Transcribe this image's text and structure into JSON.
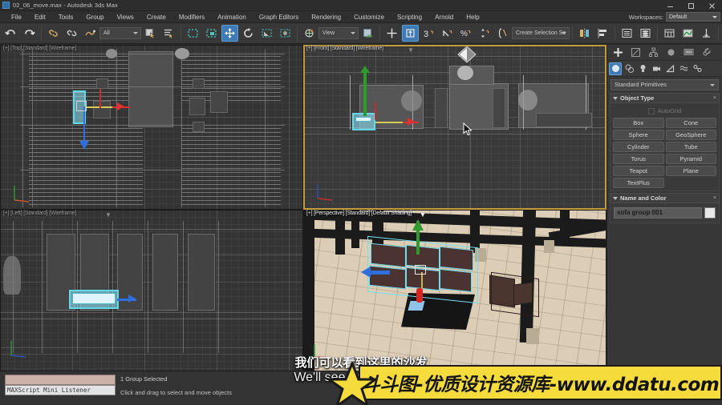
{
  "window": {
    "title": "02_06_move.max - Autodesk 3ds Max",
    "app_icon": "max-logo-icon",
    "minimize": "minimize-icon",
    "maximize": "maximize-icon",
    "close": "close-icon"
  },
  "menu": {
    "items": [
      "File",
      "Edit",
      "Tools",
      "Group",
      "Views",
      "Create",
      "Modifiers",
      "Animation",
      "Graph Editors",
      "Rendering",
      "Customize",
      "Scripting",
      "Arnold",
      "Help"
    ]
  },
  "workspaces": {
    "label": "Workspaces:",
    "value": "Default"
  },
  "toolbar": {
    "filter_value": "All",
    "ref_coord_value": "View",
    "selection_set_value": "Create Selection Se",
    "active_tool": "select-and-move",
    "buttons": [
      "undo-icon",
      "redo-icon",
      "select-and-link-icon",
      "unlink-selection-icon",
      "bind-to-space-warp-icon",
      "select-object-icon",
      "select-by-name-icon",
      "rectangular-selection-region-icon",
      "window-crossing-icon",
      "select-and-move-icon",
      "select-and-rotate-icon",
      "select-and-scale-icon",
      "use-center-flyout-icon",
      "select-and-manipulate-icon",
      "snaps-toggle-icon",
      "angle-snap-icon",
      "percent-snap-icon",
      "spinner-snap-icon",
      "named-selection-sets-icon",
      "mirror-icon",
      "align-icon",
      "layer-explorer-icon",
      "scene-explorer-icon",
      "ribbon-toggle-icon",
      "curve-editor-icon",
      "schematic-view-icon",
      "material-editor-icon",
      "render-setup-icon",
      "rendered-frame-icon",
      "render-production-icon"
    ]
  },
  "command_panel": {
    "tabs": [
      "create-tab",
      "modify-tab",
      "hierarchy-tab",
      "motion-tab",
      "display-tab",
      "utilities-tab"
    ],
    "active_tab": "create-tab",
    "categories": [
      "geometry-category",
      "shapes-category",
      "lights-category",
      "cameras-category",
      "helpers-category",
      "space-warps-category",
      "systems-category"
    ],
    "active_category": "geometry-category",
    "subcategory": "Standard Primitives",
    "object_type": {
      "title": "Object Type",
      "autogrid_label": "AutoGrid",
      "autogrid_checked": false,
      "buttons": [
        "Box",
        "Cone",
        "Sphere",
        "GeoSphere",
        "Cylinder",
        "Tube",
        "Torus",
        "Pyramid",
        "Teapot",
        "Plane",
        "TextPlus"
      ]
    },
    "name_and_color": {
      "title": "Name and Color",
      "name": "sofa group 001",
      "color": "#e8e8e8"
    }
  },
  "viewports": [
    {
      "id": "top",
      "label": "[+] [Top] [Standard] [Wireframe]",
      "active": false
    },
    {
      "id": "front",
      "label": "[+] [Front] [Standard] [Wireframe]",
      "active": true
    },
    {
      "id": "left",
      "label": "[+] [Left] [Standard] [Wireframe]",
      "active": false
    },
    {
      "id": "perspective",
      "label": "[+] [Perspective] [Standard] [Default Shading]",
      "active": false
    }
  ],
  "status_bar": {
    "mini_listener_label": "MAXScript Mini Listener",
    "selection": "1 Group Selected",
    "prompt": "Click and drag to select and move objects"
  },
  "subtitles": {
    "chinese": "我们可以看到这里的沙发",
    "english": "We'll see up here that a"
  },
  "watermark": {
    "text": "斗斗图-优质设计资源库-www.ddatu.com",
    "background": "#f5dc3c",
    "star": "star-icon"
  }
}
